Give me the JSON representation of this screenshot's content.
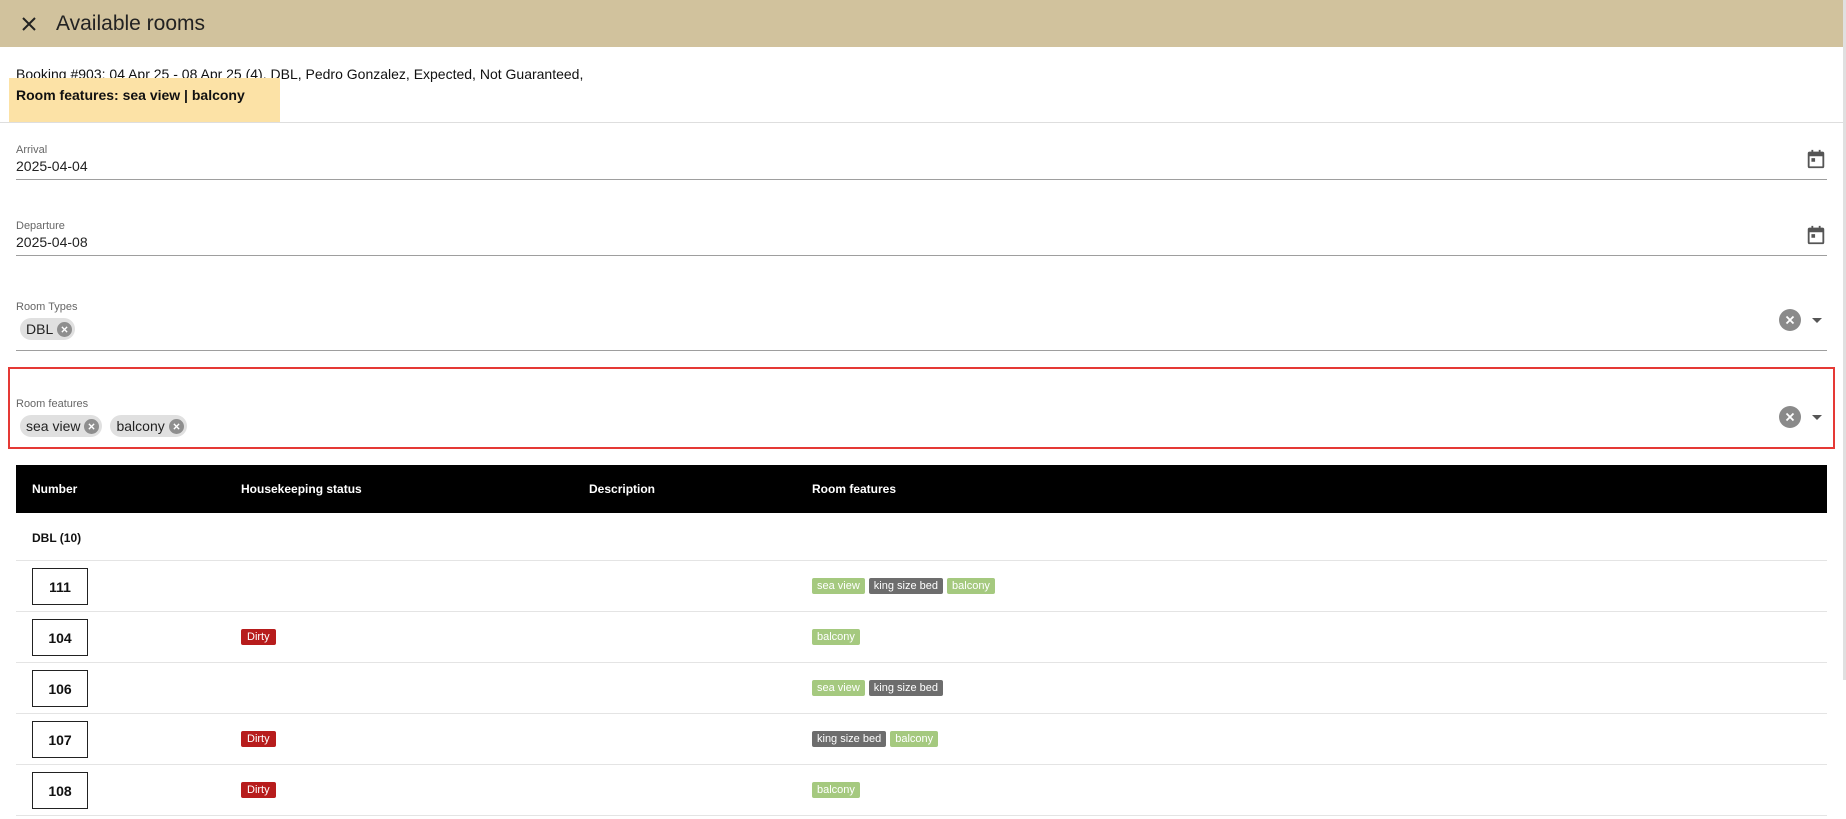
{
  "header": {
    "title": "Available rooms",
    "close_icon": "close-icon"
  },
  "booking": {
    "summary": "Booking #903: 04 Apr 25 - 08 Apr 25 (4), DBL, Pedro Gonzalez, Expected, Not Guaranteed,",
    "features_line": "Room features: sea view | balcony"
  },
  "arrival": {
    "label": "Arrival",
    "value": "2025-04-04"
  },
  "departure": {
    "label": "Departure",
    "value": "2025-04-08"
  },
  "room_types": {
    "label": "Room Types",
    "chips": [
      "DBL"
    ]
  },
  "room_features": {
    "label": "Room features",
    "chips": [
      "sea view",
      "balcony"
    ]
  },
  "table": {
    "columns": [
      "Number",
      "Housekeeping status",
      "Description",
      "Room features"
    ],
    "group": "DBL (10)",
    "rows": [
      {
        "number": "111",
        "status": "",
        "description": "",
        "features": [
          "sea view",
          "king size bed",
          "balcony"
        ]
      },
      {
        "number": "104",
        "status": "Dirty",
        "description": "",
        "features": [
          "balcony"
        ]
      },
      {
        "number": "106",
        "status": "",
        "description": "",
        "features": [
          "sea view",
          "king size bed"
        ]
      },
      {
        "number": "107",
        "status": "Dirty",
        "description": "",
        "features": [
          "king size bed",
          "balcony"
        ]
      },
      {
        "number": "108",
        "status": "Dirty",
        "description": "",
        "features": [
          "balcony"
        ]
      }
    ]
  },
  "colors": {
    "header_bg": "#d1c29d",
    "highlight_bg": "#fce2a6",
    "dirty_badge": "#b71c1c",
    "feature_green": "#a5c97f",
    "feature_gray": "#6d6d6d",
    "focus_border": "#e53935"
  }
}
